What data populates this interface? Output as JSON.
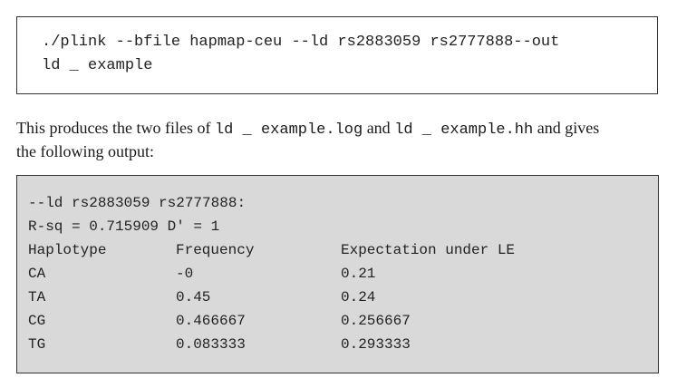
{
  "command": {
    "line1": "./plink --bfile hapmap-ceu --ld rs2883059 rs2777888--out",
    "line2": "ld _ example"
  },
  "paragraph": {
    "t1": "This produces the two files of ",
    "code1": "ld _ example.log",
    "t2": " and ",
    "code2": "ld _ example.hh",
    "t3": " and gives",
    "line2": "the following output:"
  },
  "output": {
    "header1": "--ld rs2883059 rs2777888:",
    "header2": "R-sq = 0.715909 D' = 1",
    "columns": [
      "Haplotype",
      "Frequency",
      "Expectation under LE"
    ],
    "rows": [
      [
        "CA",
        "-0",
        "0.21"
      ],
      [
        "TA",
        "0.45",
        "0.24"
      ],
      [
        "CG",
        "0.466667",
        "0.256667"
      ],
      [
        "TG",
        "0.083333",
        "0.293333"
      ]
    ]
  }
}
